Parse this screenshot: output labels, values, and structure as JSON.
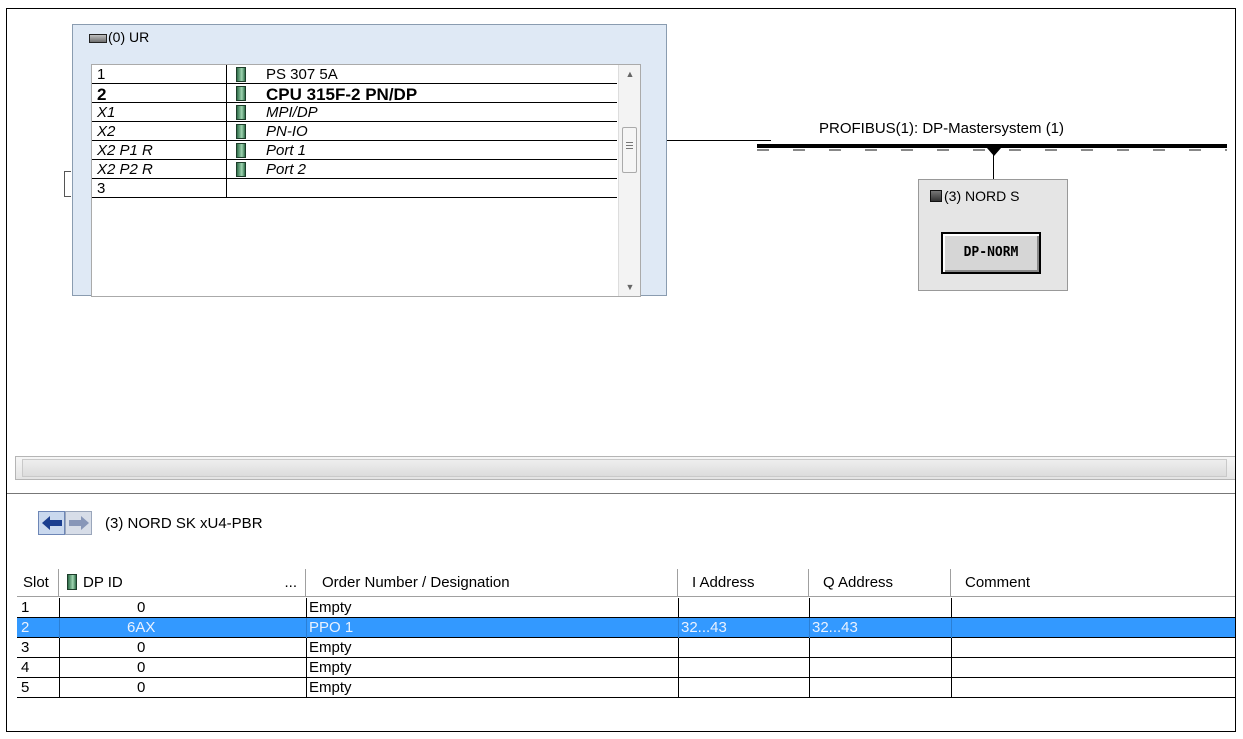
{
  "rack": {
    "title": "(0) UR",
    "rows": [
      {
        "slot": "1",
        "module": "PS 307 5A",
        "style": "normal"
      },
      {
        "slot": "2",
        "module": "CPU 315F-2 PN/DP",
        "style": "bold"
      },
      {
        "slot": "X1",
        "module": "MPI/DP",
        "style": "italic"
      },
      {
        "slot": "X2",
        "module": "PN-IO",
        "style": "italic"
      },
      {
        "slot": "X2 P1 R",
        "module": "Port 1",
        "style": "italic"
      },
      {
        "slot": "X2 P2 R",
        "module": "Port 2",
        "style": "italic"
      },
      {
        "slot": "3",
        "module": "",
        "style": "normal"
      }
    ]
  },
  "profibus": {
    "label": "PROFIBUS(1): DP-Mastersystem (1)",
    "slave_title": "(3) NORD S",
    "slave_button": "DP-NORM"
  },
  "detail": {
    "title": "(3)  NORD SK xU4-PBR",
    "columns": [
      "Slot",
      "DP ID",
      "...",
      "Order Number / Designation",
      "I Address",
      "Q Address",
      "Comment"
    ],
    "rows": [
      {
        "slot": "1",
        "dpid": "0",
        "order": "Empty",
        "iaddr": "",
        "qaddr": "",
        "comment": "",
        "selected": false
      },
      {
        "slot": "2",
        "dpid": "6AX",
        "order": "PPO 1",
        "iaddr": "32...43",
        "qaddr": "32...43",
        "comment": "",
        "selected": true
      },
      {
        "slot": "3",
        "dpid": "0",
        "order": "Empty",
        "iaddr": "",
        "qaddr": "",
        "comment": "",
        "selected": false
      },
      {
        "slot": "4",
        "dpid": "0",
        "order": "Empty",
        "iaddr": "",
        "qaddr": "",
        "comment": "",
        "selected": false
      },
      {
        "slot": "5",
        "dpid": "0",
        "order": "Empty",
        "iaddr": "",
        "qaddr": "",
        "comment": "",
        "selected": false
      }
    ]
  },
  "icons": {
    "rack": "rack-icon",
    "module": "module-icon",
    "device": "dp-slave-icon",
    "back": "arrow-left-icon",
    "forward": "arrow-right-icon"
  },
  "colors": {
    "selection": "#3399ff",
    "rack_background": "#dfe9f5",
    "slave_background": "#e5e5e5"
  }
}
